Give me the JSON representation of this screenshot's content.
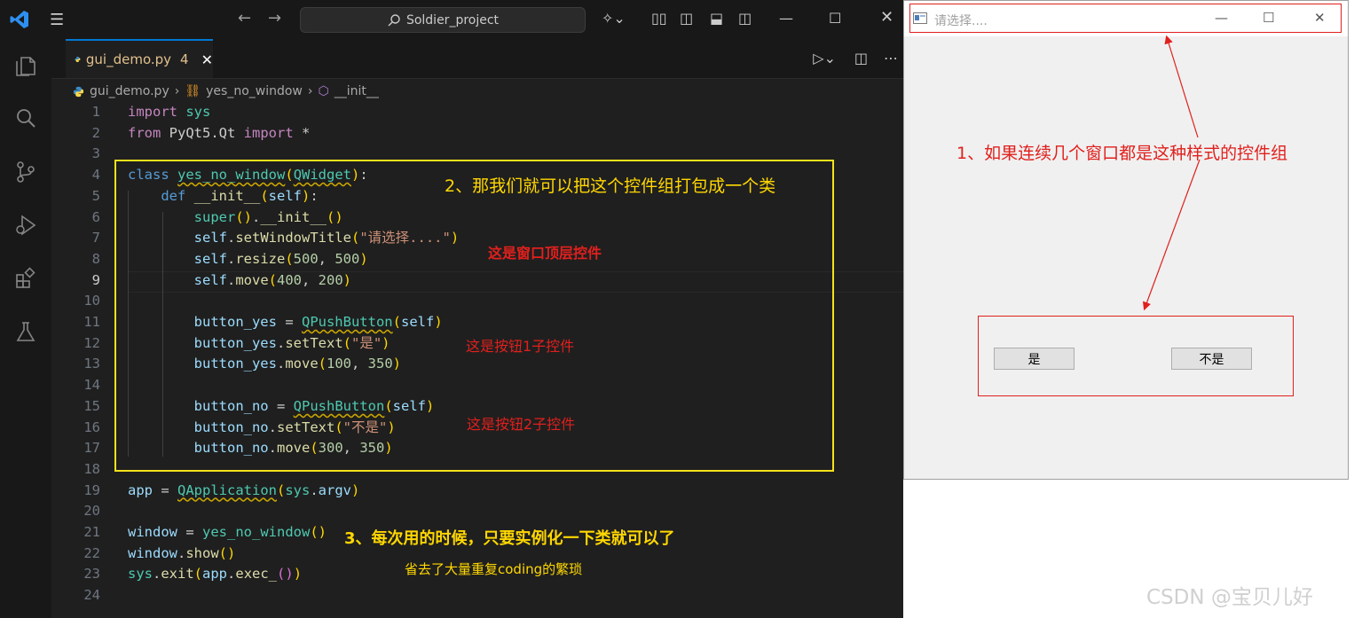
{
  "titlebar": {
    "search_text": "Soldier_project"
  },
  "tab": {
    "filename": "gui_demo.py",
    "problem_count": "4"
  },
  "breadcrumb": {
    "file": "gui_demo.py",
    "class": "yes_no_window",
    "method": "__init__"
  },
  "line_numbers": [
    "1",
    "2",
    "3",
    "4",
    "5",
    "6",
    "7",
    "8",
    "9",
    "10",
    "11",
    "12",
    "13",
    "14",
    "15",
    "16",
    "17",
    "18",
    "19",
    "20",
    "21",
    "22",
    "23",
    "24"
  ],
  "code": {
    "l1_a": "import",
    "l1_b": "sys",
    "l2_a": "from",
    "l2_b": "PyQt5.Qt",
    "l2_c": "import",
    "l2_d": "*",
    "l4_a": "class",
    "l4_b": "yes_no_window",
    "l4_c": "QWidget",
    "l5_a": "def",
    "l5_b": "__init__",
    "l5_c": "self",
    "l6_a": "super",
    "l6_b": "__init__",
    "l7_a": "self",
    "l7_b": "setWindowTitle",
    "l7_c": "\"请选择....\"",
    "l8_a": "self",
    "l8_b": "resize",
    "l8_c": "500",
    "l8_d": "500",
    "l9_a": "self",
    "l9_b": "move",
    "l9_c": "400",
    "l9_d": "200",
    "l11_a": "button_yes",
    "l11_b": "QPushButton",
    "l11_c": "self",
    "l12_a": "button_yes",
    "l12_b": "setText",
    "l12_c": "\"是\"",
    "l13_a": "button_yes",
    "l13_b": "move",
    "l13_c": "100",
    "l13_d": "350",
    "l15_a": "button_no",
    "l15_b": "QPushButton",
    "l15_c": "self",
    "l16_a": "button_no",
    "l16_b": "setText",
    "l16_c": "\"不是\"",
    "l17_a": "button_no",
    "l17_b": "move",
    "l17_c": "300",
    "l17_d": "350",
    "l19_a": "app",
    "l19_b": "QApplication",
    "l19_c": "sys",
    "l19_d": "argv",
    "l21_a": "window",
    "l21_b": "yes_no_window",
    "l22_a": "window",
    "l22_b": "show",
    "l23_a": "sys",
    "l23_b": "exit",
    "l23_c": "app",
    "l23_d": "exec_"
  },
  "annotations": {
    "a1": "1、如果连续几个窗口都是这种样式的控件组",
    "a2": "2、那我们就可以把这个控件组打包成一个类",
    "a3": "3、每次用的时候，只要实例化一下类就可以了",
    "a4": "这是窗口顶层控件",
    "a5": "这是按钮1子控件",
    "a6": "这是按钮2子控件",
    "a7": "省去了大量重复coding的繁琐"
  },
  "qt_window": {
    "title": "请选择....",
    "btn_yes": "是",
    "btn_no": "不是"
  },
  "watermark": "CSDN @宝贝儿好",
  "colors": {
    "annotation_red": "#e0201d",
    "annotation_yellow": "#ffd700",
    "accent": "#0078d4"
  }
}
